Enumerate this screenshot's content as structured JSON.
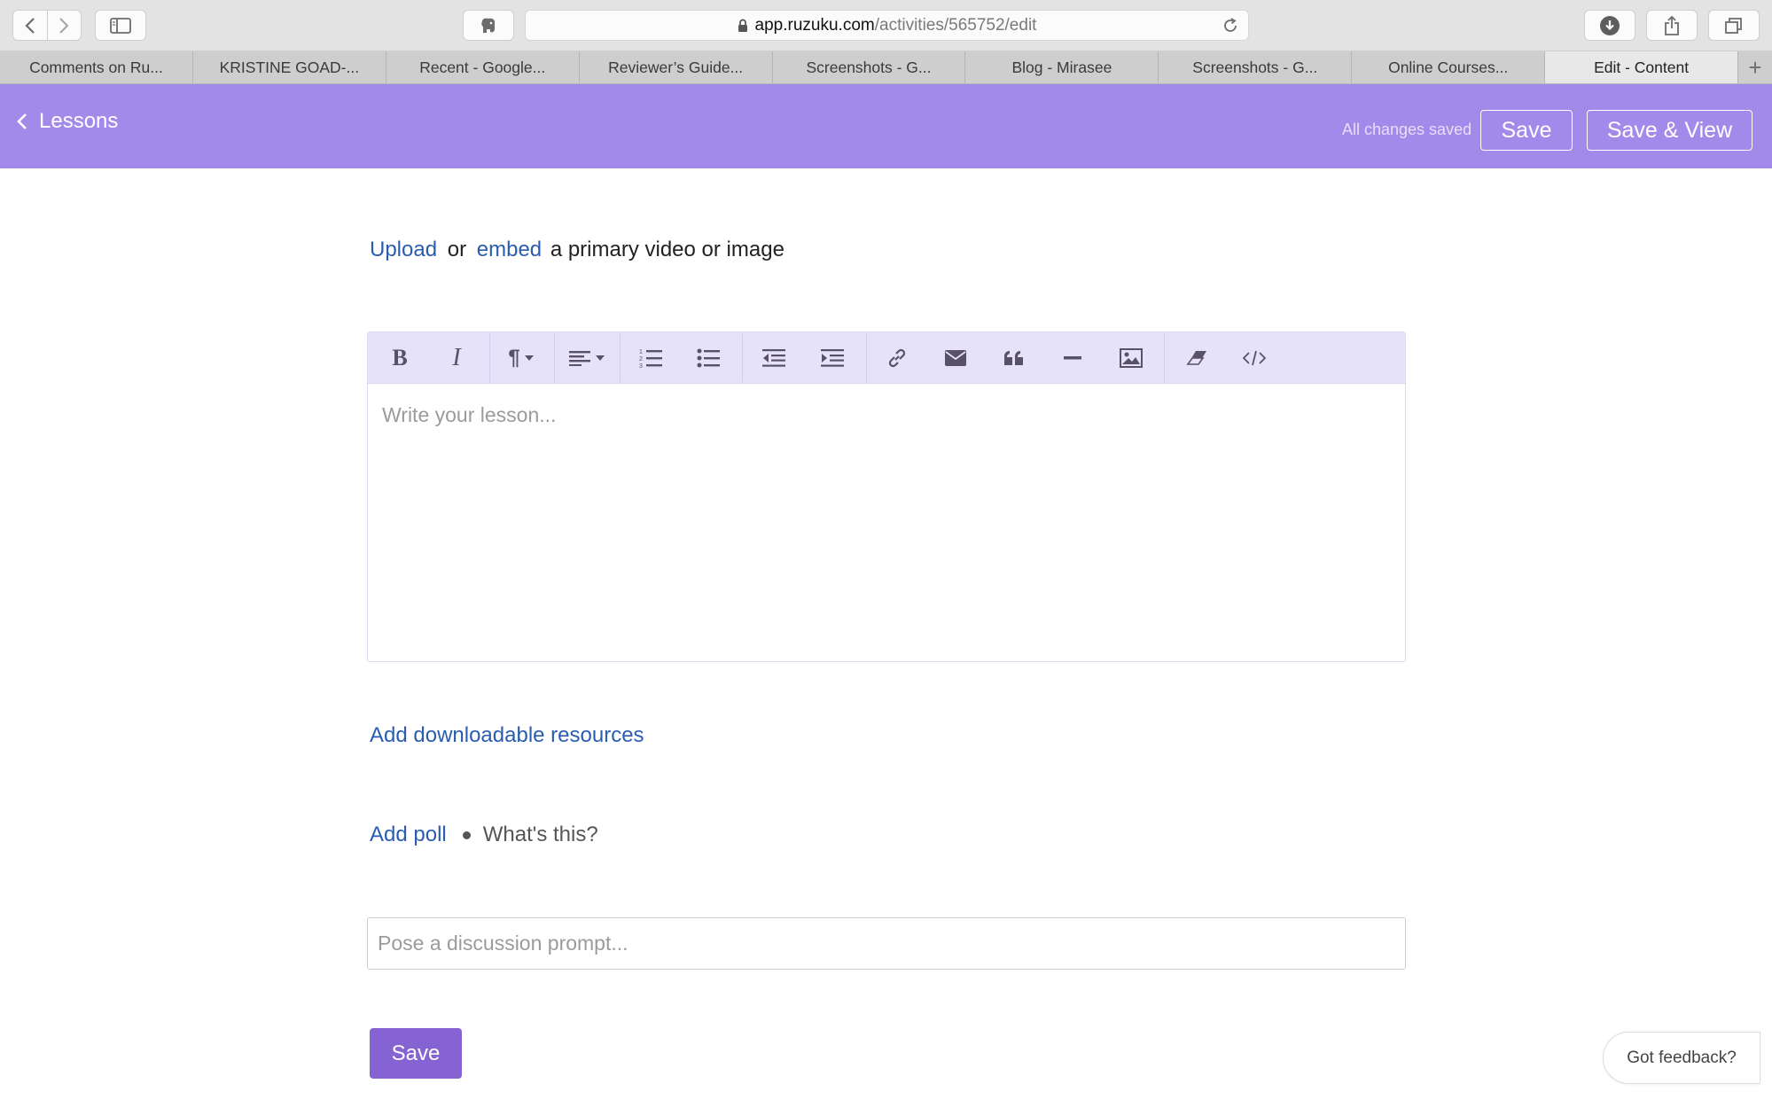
{
  "browser": {
    "address_host": "app.ruzuku.com",
    "address_path": "/activities/565752/edit",
    "tabs": [
      {
        "label": "Comments on Ru..."
      },
      {
        "label": "KRISTINE GOAD-..."
      },
      {
        "label": "Recent - Google..."
      },
      {
        "label": "Reviewer’s Guide..."
      },
      {
        "label": "Screenshots - G..."
      },
      {
        "label": "Blog - Mirasee"
      },
      {
        "label": "Screenshots - G..."
      },
      {
        "label": "Online Courses..."
      },
      {
        "label": "Edit - Content",
        "active": true
      }
    ]
  },
  "header": {
    "back_label": "Lessons",
    "status": "All changes saved",
    "save_label": "Save",
    "save_view_label": "Save & View",
    "color": "#a28aea"
  },
  "content": {
    "upload_link": "Upload",
    "or_text": "or",
    "embed_link": "embed",
    "upload_suffix": "a primary video or image",
    "editor": {
      "placeholder": "Write your lesson...",
      "tools": [
        "bold-icon",
        "italic-icon",
        "paragraph-format-icon",
        "align-icon",
        "ordered-list-icon",
        "unordered-list-icon",
        "outdent-icon",
        "indent-icon",
        "link-icon",
        "email-icon",
        "quote-icon",
        "horizontal-rule-icon",
        "image-icon",
        "clear-format-icon",
        "code-view-icon"
      ]
    },
    "resources_link": "Add downloadable resources",
    "poll_link": "Add poll",
    "poll_help": "What's this?",
    "discussion_placeholder": "Pose a discussion prompt...",
    "save_label": "Save",
    "save_color": "#8563d3",
    "link_color": "#2a5db0"
  },
  "feedback": {
    "label": "Got feedback?"
  }
}
